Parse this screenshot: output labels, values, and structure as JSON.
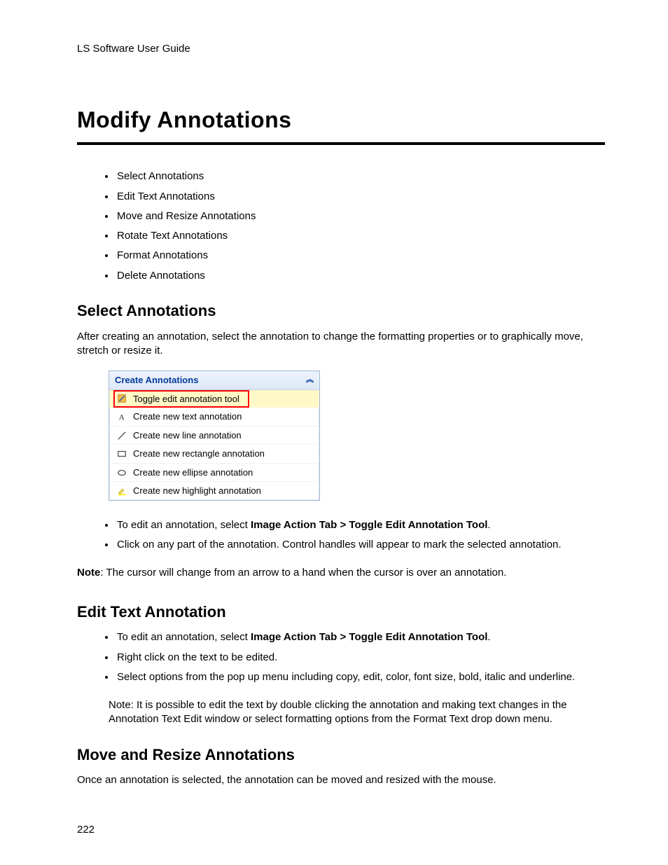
{
  "header": {
    "guide_title": "LS Software User Guide"
  },
  "title": "Modify Annotations",
  "toc": [
    "Select Annotations",
    "Edit Text Annotations",
    "Move and Resize Annotations",
    "Rotate Text Annotations",
    "Format Annotations",
    "Delete Annotations"
  ],
  "sections": {
    "select": {
      "heading": "Select Annotations",
      "intro": "After creating an annotation, select the annotation to change the formatting properties or to graphically move, stretch or resize it.",
      "panel": {
        "title": "Create Annotations",
        "items": [
          {
            "label": "Toggle edit annotation tool",
            "icon": "edit-icon",
            "selected": true
          },
          {
            "label": "Create new text annotation",
            "icon": "text-icon",
            "selected": false
          },
          {
            "label": "Create new line annotation",
            "icon": "line-icon",
            "selected": false
          },
          {
            "label": "Create new rectangle annotation",
            "icon": "rect-icon",
            "selected": false
          },
          {
            "label": "Create new ellipse annotation",
            "icon": "ellipse-icon",
            "selected": false
          },
          {
            "label": "Create new highlight annotation",
            "icon": "highlight-icon",
            "selected": false
          }
        ]
      },
      "bullets": [
        {
          "pre": "To edit an annotation, select ",
          "bold": "Image Action Tab > Toggle Edit Annotation Tool",
          "post": "."
        },
        {
          "pre": "Click on any part of the annotation. Control handles will appear to mark the selected annotation.",
          "bold": "",
          "post": ""
        }
      ],
      "note_label": "Note",
      "note_text": ":  The cursor will change from an arrow to a hand when the cursor is over an annotation."
    },
    "edit": {
      "heading": "Edit Text Annotation",
      "bullets": [
        {
          "pre": "To edit an annotation, select ",
          "bold": "Image Action Tab > Toggle Edit Annotation Tool",
          "post": "."
        },
        {
          "pre": "Right click on the text to be edited.",
          "bold": "",
          "post": ""
        },
        {
          "pre": "Select options from the pop up menu including copy, edit, color, font size, bold, italic and underline.",
          "bold": "",
          "post": ""
        }
      ],
      "note": "Note: It is possible to edit the text by double clicking the annotation and making text changes in the Annotation Text Edit window or select formatting options from the Format Text drop down menu."
    },
    "move": {
      "heading": "Move and Resize Annotations",
      "intro": "Once an annotation is selected, the annotation can be moved and resized with the mouse."
    }
  },
  "page_number": "222"
}
